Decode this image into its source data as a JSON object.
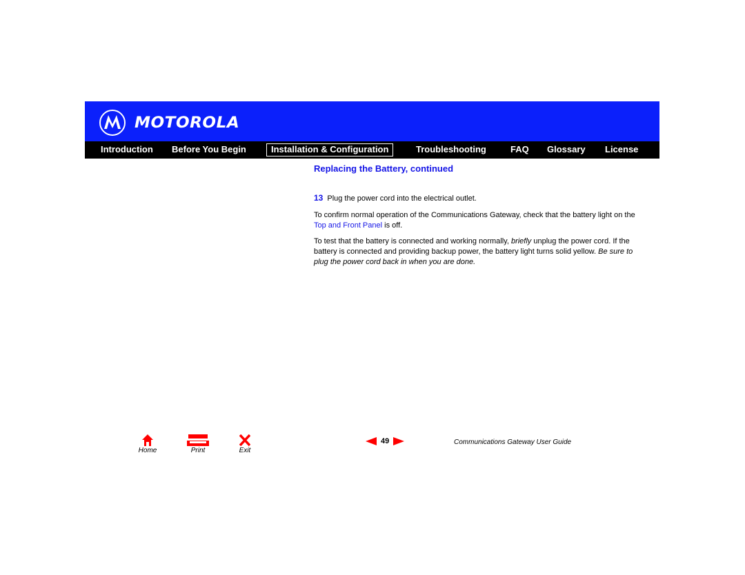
{
  "brand": {
    "name": "MOTOROLA",
    "header_color": "#0b20fb"
  },
  "nav": {
    "items": [
      {
        "label": "Introduction"
      },
      {
        "label": "Before You Begin"
      },
      {
        "label": "Installation & Configuration",
        "active": true
      },
      {
        "label": "Troubleshooting"
      },
      {
        "label": "FAQ"
      },
      {
        "label": "Glossary"
      },
      {
        "label": "License"
      }
    ]
  },
  "page": {
    "section_title": "Replacing the Battery, continued",
    "step": {
      "number": "13",
      "text": "Plug the power cord into the electrical outlet."
    },
    "para1": {
      "before_link": "To confirm normal operation of the Communications Gateway, check that the battery light on the ",
      "link": "Top and Front Panel",
      "after_link": " is off."
    },
    "para2": {
      "part1": "To test that the battery is connected and working normally, ",
      "emphasis1": "briefly",
      "part2": " unplug the power cord. If the battery is connected and providing backup power, the battery light turns solid yellow. ",
      "emphasis2": "Be sure to plug the power cord back in when you are done."
    }
  },
  "footer": {
    "home_label": "Home",
    "print_label": "Print",
    "exit_label": "Exit",
    "page_number": "49",
    "guide_title": "Communications Gateway User Guide",
    "icon_color": "#ff0000"
  }
}
